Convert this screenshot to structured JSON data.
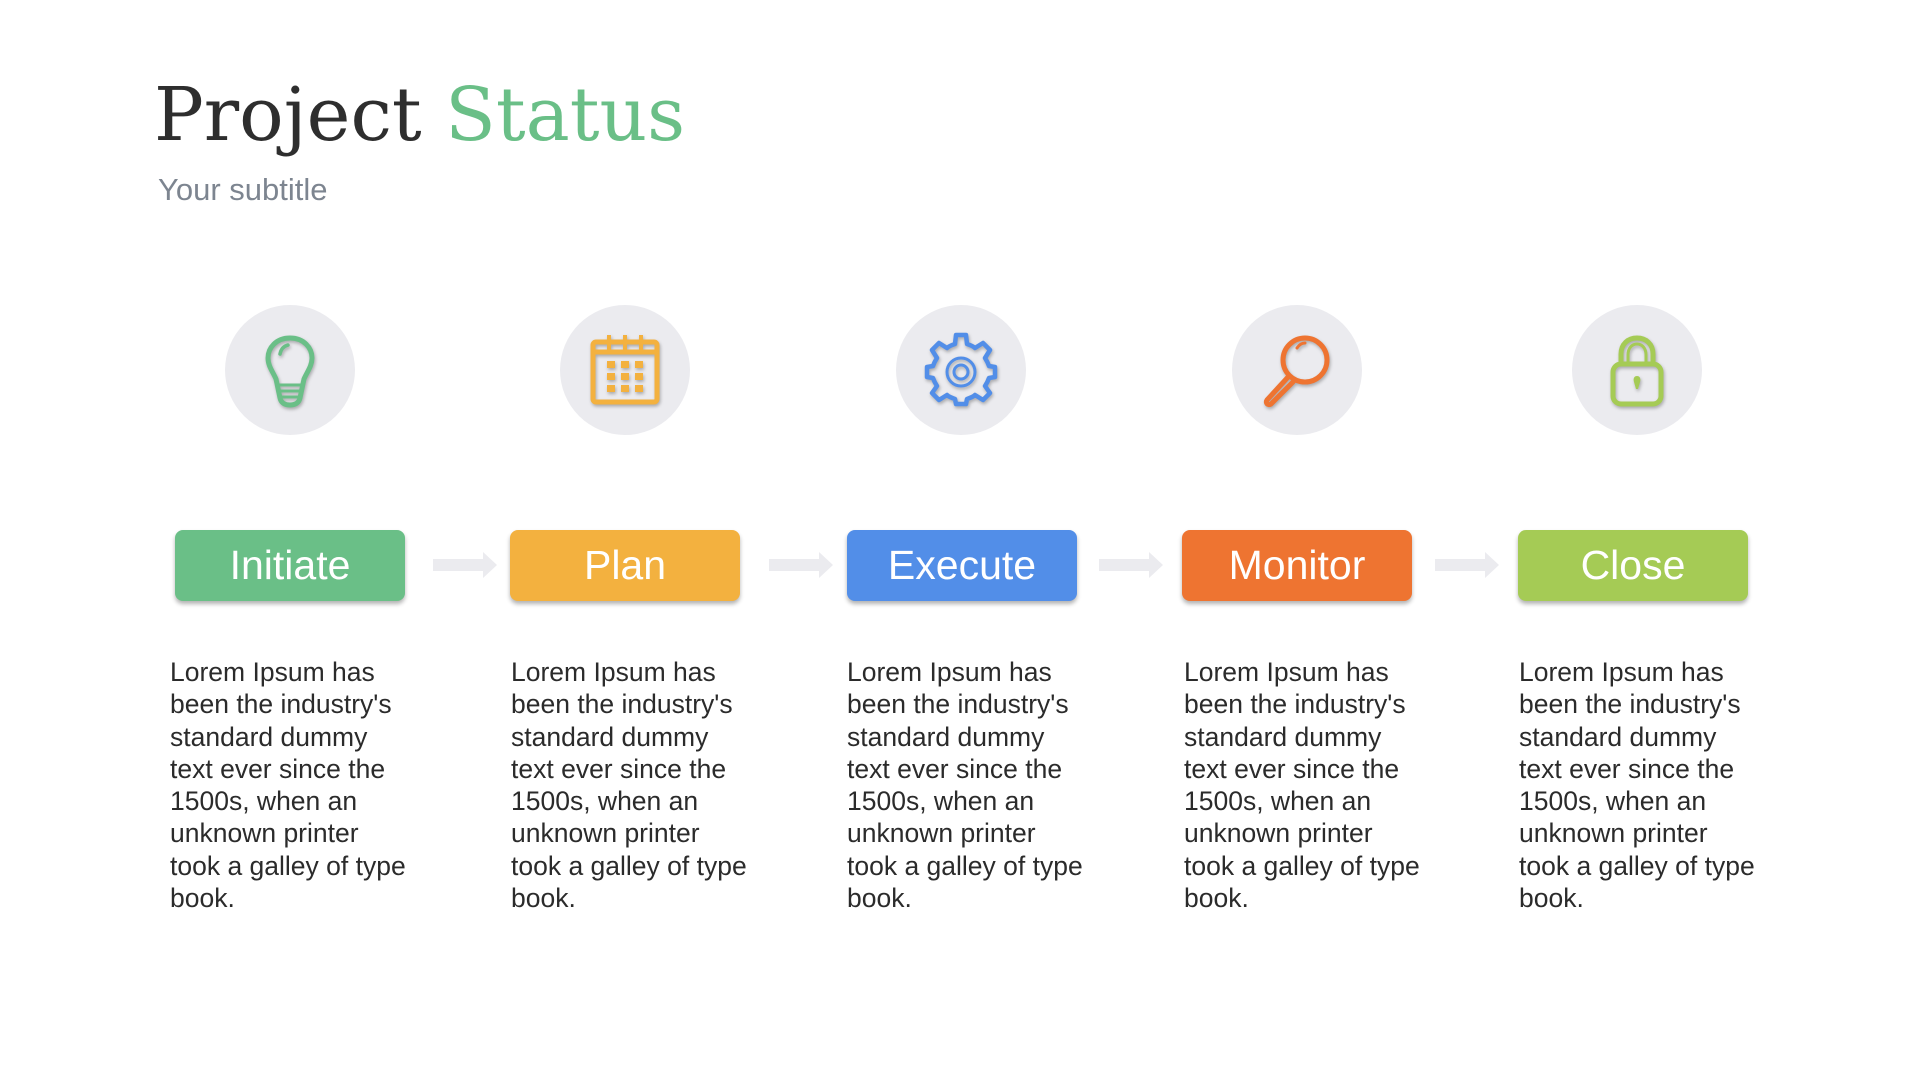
{
  "header": {
    "title_part1": "Project",
    "title_part2": "Status",
    "subtitle": "Your subtitle"
  },
  "colors": {
    "green": "#6abf87",
    "yellow": "#f3b13f",
    "blue": "#528ee8",
    "orange": "#ee7431",
    "lime": "#a5cb55",
    "circle_bg": "#ebebef",
    "arrow": "#ebebef"
  },
  "stages": [
    {
      "label": "Initiate",
      "icon": "lightbulb-icon",
      "color": "#6abf87",
      "description": "Lorem Ipsum has been the industry's standard dummy text ever since the 1500s, when an unknown printer took a galley of type book."
    },
    {
      "label": "Plan",
      "icon": "calendar-icon",
      "color": "#f3b13f",
      "description": "Lorem Ipsum has been the industry's standard dummy text ever since the 1500s, when an unknown printer took a galley of type book."
    },
    {
      "label": "Execute",
      "icon": "gear-icon",
      "color": "#528ee8",
      "description": "Lorem Ipsum has been the industry's standard dummy text ever since the 1500s, when an unknown printer took a galley of type book."
    },
    {
      "label": "Monitor",
      "icon": "magnifier-icon",
      "color": "#ee7431",
      "description": "Lorem Ipsum has been the industry's standard dummy text ever since the 1500s, when an unknown printer took a galley of type book."
    },
    {
      "label": "Close",
      "icon": "padlock-icon",
      "color": "#a5cb55",
      "description": "Lorem Ipsum has been the industry's standard dummy text ever since the 1500s, when an unknown printer took a galley of type book."
    }
  ]
}
